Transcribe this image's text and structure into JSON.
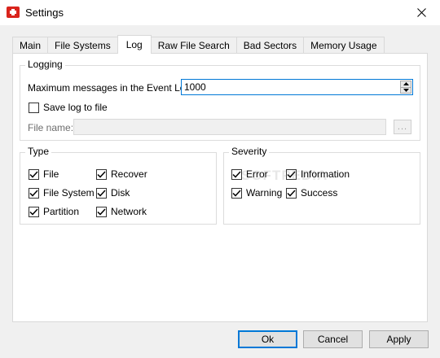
{
  "window": {
    "title": "Settings",
    "app_icon": "red-cross-icon",
    "close_icon": "close-icon"
  },
  "tabs": [
    {
      "label": "Main",
      "active": false
    },
    {
      "label": "File Systems",
      "active": false
    },
    {
      "label": "Log",
      "active": true
    },
    {
      "label": "Raw File Search",
      "active": false
    },
    {
      "label": "Bad Sectors",
      "active": false
    },
    {
      "label": "Memory Usage",
      "active": false
    }
  ],
  "logging": {
    "group_label": "Logging",
    "max_messages_label": "Maximum messages in the Event Log:",
    "max_messages_value": "1000",
    "save_log_label": "Save log to file",
    "save_log_checked": false,
    "file_name_label": "File name:",
    "file_name_value": "",
    "browse_label": "..."
  },
  "type_group": {
    "label": "Type",
    "items": [
      {
        "label": "File",
        "checked": true
      },
      {
        "label": "Recover",
        "checked": true
      },
      {
        "label": "File System",
        "checked": true
      },
      {
        "label": "Disk",
        "checked": true
      },
      {
        "label": "Partition",
        "checked": true
      },
      {
        "label": "Network",
        "checked": true
      }
    ]
  },
  "severity_group": {
    "label": "Severity",
    "items": [
      {
        "label": "Error",
        "checked": true
      },
      {
        "label": "Information",
        "checked": true
      },
      {
        "label": "Warning",
        "checked": true
      },
      {
        "label": "Success",
        "checked": true
      }
    ]
  },
  "watermark": "SOFTPEDIA",
  "buttons": {
    "ok": "Ok",
    "cancel": "Cancel",
    "apply": "Apply"
  },
  "colors": {
    "accent": "#0078d7",
    "app_icon": "#d9241c",
    "window_bg": "#f0f0f0"
  }
}
